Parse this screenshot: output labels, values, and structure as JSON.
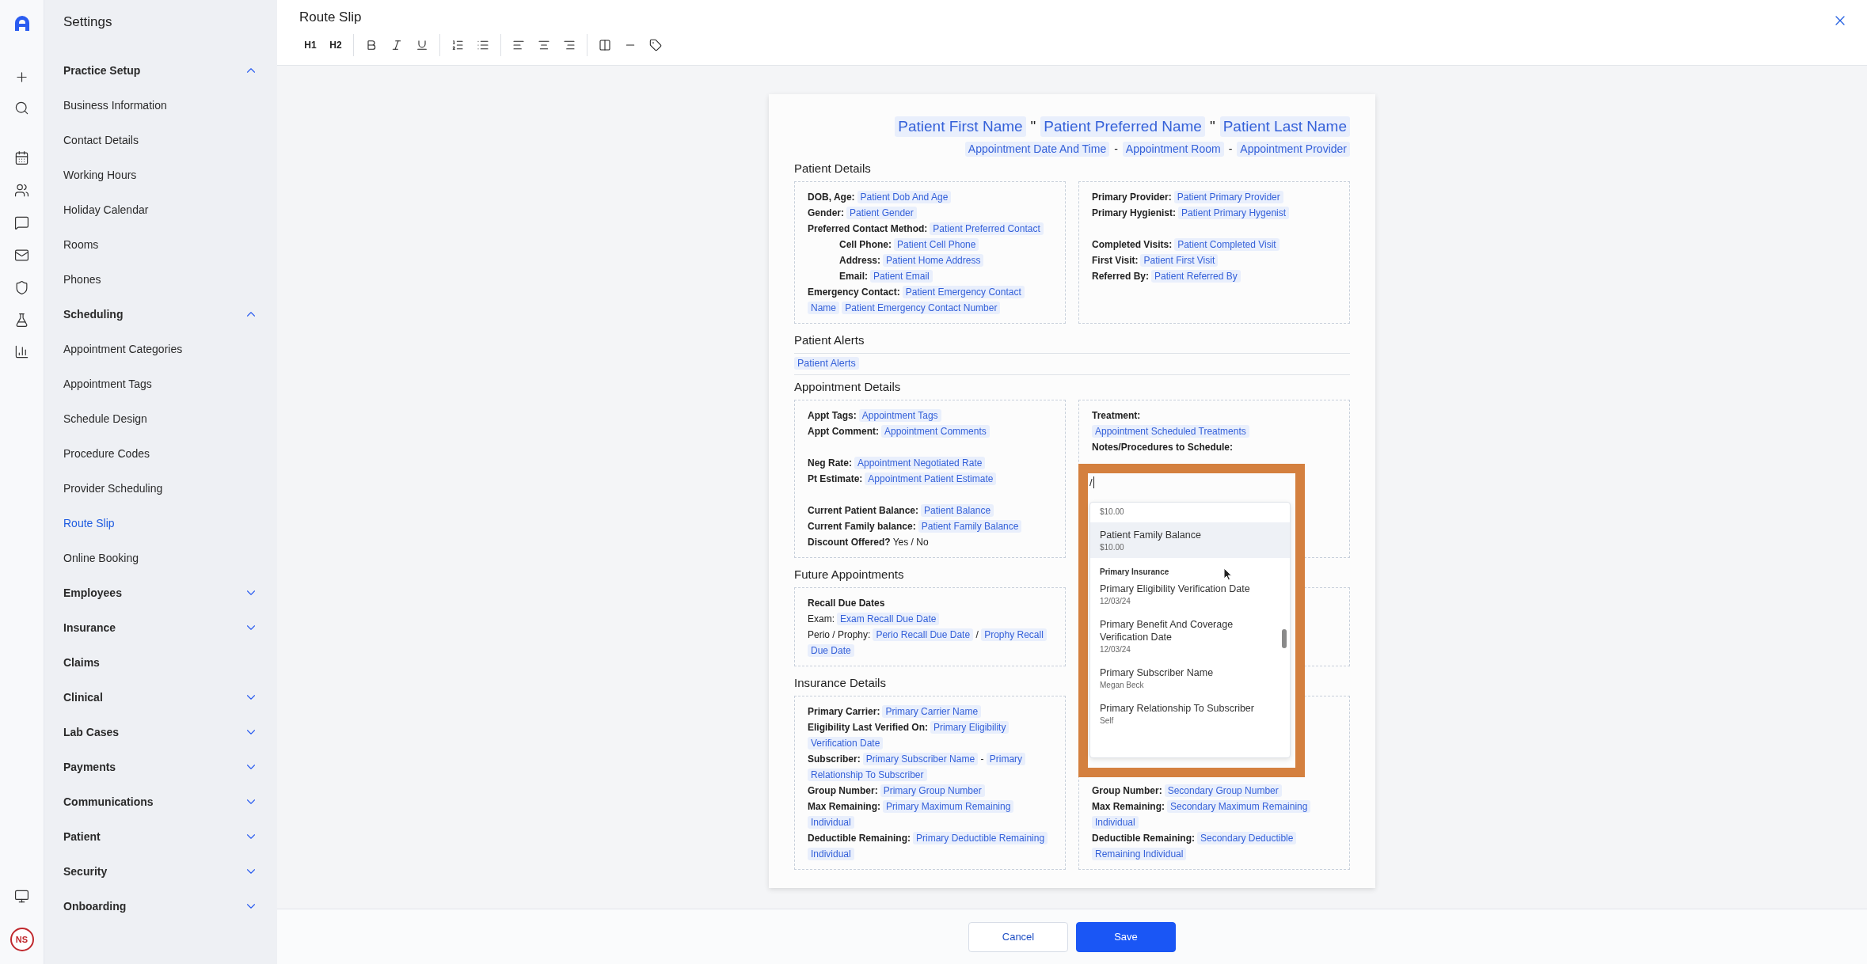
{
  "sidebar": {
    "title": "Settings",
    "sections": [
      {
        "label": "Practice Setup",
        "kind": "group",
        "expanded": true,
        "items": [
          {
            "label": "Business Information",
            "selected": false
          },
          {
            "label": "Contact Details",
            "selected": false
          },
          {
            "label": "Working Hours",
            "selected": false
          },
          {
            "label": "Holiday Calendar",
            "selected": false
          },
          {
            "label": "Rooms",
            "selected": false
          },
          {
            "label": "Phones",
            "selected": false
          }
        ]
      },
      {
        "label": "Scheduling",
        "kind": "group",
        "expanded": true,
        "items": [
          {
            "label": "Appointment Categories",
            "selected": false
          },
          {
            "label": "Appointment Tags",
            "selected": false
          },
          {
            "label": "Schedule Design",
            "selected": false
          },
          {
            "label": "Procedure Codes",
            "selected": false
          },
          {
            "label": "Provider Scheduling",
            "selected": false
          },
          {
            "label": "Route Slip",
            "selected": true
          },
          {
            "label": "Online Booking",
            "selected": false
          }
        ]
      },
      {
        "label": "Employees",
        "kind": "group",
        "expanded": false
      },
      {
        "label": "Insurance",
        "kind": "group",
        "expanded": false
      },
      {
        "label": "Claims",
        "kind": "link"
      },
      {
        "label": "Clinical",
        "kind": "group",
        "expanded": false
      },
      {
        "label": "Lab Cases",
        "kind": "group",
        "expanded": false
      },
      {
        "label": "Payments",
        "kind": "group",
        "expanded": false
      },
      {
        "label": "Communications",
        "kind": "group",
        "expanded": false
      },
      {
        "label": "Patient",
        "kind": "group",
        "expanded": false
      },
      {
        "label": "Security",
        "kind": "group",
        "expanded": false
      },
      {
        "label": "Onboarding",
        "kind": "group",
        "expanded": false
      }
    ]
  },
  "avatar": {
    "initials": "NS"
  },
  "editor": {
    "title": "Route Slip",
    "toolbar": [
      [
        {
          "kind": "text",
          "label": "H1"
        },
        {
          "kind": "text",
          "label": "H2"
        }
      ],
      [
        {
          "kind": "bold"
        },
        {
          "kind": "italic"
        },
        {
          "kind": "underline"
        }
      ],
      [
        {
          "kind": "numbered-list"
        },
        {
          "kind": "bullet-list"
        }
      ],
      [
        {
          "kind": "align-left"
        },
        {
          "kind": "align-center"
        },
        {
          "kind": "align-right"
        }
      ],
      [
        {
          "kind": "columns"
        },
        {
          "kind": "rule"
        },
        {
          "kind": "tag"
        }
      ]
    ]
  },
  "document": {
    "title_line": [
      {
        "kind": "chip",
        "text": "Patient First Name"
      },
      {
        "kind": "text",
        "text": "\""
      },
      {
        "kind": "chip",
        "text": "Patient Preferred Name"
      },
      {
        "kind": "text",
        "text": "\""
      },
      {
        "kind": "chip",
        "text": "Patient Last Name"
      }
    ],
    "subtitle_line": [
      {
        "kind": "chip",
        "text": "Appointment Date And Time"
      },
      {
        "kind": "text",
        "text": "-"
      },
      {
        "kind": "chip",
        "text": "Appointment Room"
      },
      {
        "kind": "text",
        "text": "-"
      },
      {
        "kind": "chip",
        "text": "Appointment Provider"
      }
    ],
    "sections": [
      {
        "heading": "Patient Details",
        "boxes": [
          {
            "lines": [
              {
                "kind": "field",
                "label": "DOB, Age:",
                "parts": [
                  {
                    "kind": "chip",
                    "text": "Patient Dob And Age"
                  }
                ]
              },
              {
                "kind": "field",
                "label": "Gender:",
                "parts": [
                  {
                    "kind": "chip",
                    "text": "Patient Gender"
                  }
                ]
              },
              {
                "kind": "field",
                "label": "Preferred Contact Method:",
                "parts": [
                  {
                    "kind": "chip",
                    "text": "Patient Preferred Contact"
                  }
                ],
                "children": [
                  {
                    "kind": "field",
                    "label": "Cell Phone:",
                    "parts": [
                      {
                        "kind": "chip",
                        "text": "Patient Cell Phone"
                      }
                    ]
                  },
                  {
                    "kind": "field",
                    "label": "Address:",
                    "parts": [
                      {
                        "kind": "chip",
                        "text": "Patient Home Address"
                      }
                    ]
                  },
                  {
                    "kind": "field",
                    "label": "Email:",
                    "parts": [
                      {
                        "kind": "chip",
                        "text": "Patient Email"
                      }
                    ]
                  }
                ]
              },
              {
                "kind": "field",
                "label": "Emergency Contact:",
                "parts": [
                  {
                    "kind": "chip",
                    "text": "Patient Emergency Contact"
                  },
                  {
                    "kind": "chip",
                    "text": "Name"
                  },
                  {
                    "kind": "chip",
                    "text": "Patient Emergency Contact Number"
                  }
                ]
              }
            ]
          },
          {
            "lines": [
              {
                "kind": "field",
                "label": "Primary Provider:",
                "parts": [
                  {
                    "kind": "chip",
                    "text": "Patient Primary Provider"
                  }
                ]
              },
              {
                "kind": "field",
                "label": "Primary Hygienist:",
                "parts": [
                  {
                    "kind": "chip",
                    "text": "Patient Primary Hygenist"
                  }
                ]
              },
              {
                "kind": "gap"
              },
              {
                "kind": "field",
                "label": "Completed Visits:",
                "parts": [
                  {
                    "kind": "chip",
                    "text": "Patient Completed Visit"
                  }
                ]
              },
              {
                "kind": "field",
                "label": "First Visit:",
                "parts": [
                  {
                    "kind": "chip",
                    "text": "Patient First Visit"
                  }
                ]
              },
              {
                "kind": "field",
                "label": "Referred By:",
                "parts": [
                  {
                    "kind": "chip",
                    "text": "Patient Referred By"
                  }
                ]
              }
            ]
          }
        ]
      },
      {
        "heading": "Patient Alerts",
        "parts": [
          {
            "kind": "chip",
            "text": "Patient Alerts"
          }
        ]
      },
      {
        "heading": "Appointment Details",
        "boxes": [
          {
            "lines": [
              {
                "kind": "field",
                "label": "Appt Tags:",
                "parts": [
                  {
                    "kind": "chip",
                    "text": "Appointment Tags"
                  }
                ]
              },
              {
                "kind": "field",
                "label": "Appt Comment:",
                "parts": [
                  {
                    "kind": "chip",
                    "text": "Appointment Comments"
                  }
                ]
              },
              {
                "kind": "gap"
              },
              {
                "kind": "field",
                "label": "Neg Rate:",
                "parts": [
                  {
                    "kind": "chip",
                    "text": "Appointment Negotiated Rate"
                  }
                ]
              },
              {
                "kind": "field",
                "label": "Pt Estimate:",
                "parts": [
                  {
                    "kind": "chip",
                    "text": "Appointment Patient Estimate"
                  }
                ]
              },
              {
                "kind": "gap"
              },
              {
                "kind": "field",
                "label": "Current Patient Balance:",
                "parts": [
                  {
                    "kind": "chip",
                    "text": "Patient Balance"
                  }
                ]
              },
              {
                "kind": "field",
                "label": "Current Family balance:",
                "parts": [
                  {
                    "kind": "chip",
                    "text": "Patient Family Balance"
                  }
                ]
              },
              {
                "kind": "field",
                "label": "Discount Offered?",
                "parts": [
                  {
                    "kind": "text",
                    "text": "Yes / No"
                  }
                ]
              }
            ]
          },
          {
            "lines": [
              {
                "kind": "field",
                "label": "Treatment:"
              },
              {
                "kind": "field",
                "parts": [
                  {
                    "kind": "chip",
                    "text": "Appointment Scheduled Treatments"
                  }
                ]
              },
              {
                "kind": "field",
                "label": "Notes/Procedures to Schedule:"
              }
            ],
            "menu": {
              "query": "/",
              "items": [
                {
                  "kind": "option",
                  "detail": "$10.00",
                  "selected": false
                },
                {
                  "kind": "option",
                  "title": "Patient Family Balance",
                  "detail": "$10.00",
                  "selected": true
                },
                {
                  "kind": "group",
                  "label": "Primary Insurance"
                },
                {
                  "kind": "option",
                  "title": "Primary Eligibility Verification Date",
                  "detail": "12/03/24",
                  "selected": false
                },
                {
                  "kind": "option",
                  "title": "Primary Benefit And Coverage Verification Date",
                  "detail": "12/03/24",
                  "selected": false
                },
                {
                  "kind": "option",
                  "title": "Primary Subscriber Name",
                  "detail": "Megan Beck",
                  "selected": false
                },
                {
                  "kind": "option",
                  "title": "Primary Relationship To Subscriber",
                  "detail": "Self",
                  "selected": false
                }
              ]
            }
          }
        ]
      },
      {
        "heading": "Future Appointments",
        "boxes": [
          {
            "lines": [
              {
                "kind": "field",
                "label": "Recall Due Dates"
              },
              {
                "kind": "plain",
                "label": "Exam:",
                "parts": [
                  {
                    "kind": "chip",
                    "text": "Exam Recall Due Date"
                  }
                ]
              },
              {
                "kind": "plain",
                "label": "Perio / Prophy:",
                "parts": [
                  {
                    "kind": "chip",
                    "text": "Perio Recall Due Date"
                  },
                  {
                    "kind": "text",
                    "text": "/"
                  },
                  {
                    "kind": "chip",
                    "text": "Prophy Recall"
                  },
                  {
                    "kind": "chip",
                    "text": "Due Date"
                  }
                ]
              }
            ]
          },
          {
            "lines": [
              {
                "kind": "gap"
              },
              {
                "kind": "gap"
              },
              {
                "kind": "gap"
              }
            ]
          }
        ]
      },
      {
        "heading": "Insurance Details",
        "boxes": [
          {
            "lines": [
              {
                "kind": "field",
                "label": "Primary Carrier:",
                "parts": [
                  {
                    "kind": "chip",
                    "text": "Primary Carrier Name"
                  }
                ]
              },
              {
                "kind": "field",
                "label": "Eligibility Last Verified On:",
                "parts": [
                  {
                    "kind": "chip",
                    "text": "Primary Eligibility"
                  },
                  {
                    "kind": "chip",
                    "text": "Verification Date"
                  }
                ]
              },
              {
                "kind": "field",
                "label": "Subscriber:",
                "parts": [
                  {
                    "kind": "chip",
                    "text": "Primary Subscriber Name"
                  },
                  {
                    "kind": "text",
                    "text": "-"
                  },
                  {
                    "kind": "chip",
                    "text": "Primary"
                  },
                  {
                    "kind": "chip",
                    "text": "Relationship To Subscriber"
                  }
                ]
              },
              {
                "kind": "field",
                "label": "Group Number:",
                "parts": [
                  {
                    "kind": "chip",
                    "text": "Primary Group Number"
                  }
                ]
              },
              {
                "kind": "field",
                "label": "Max Remaining:",
                "parts": [
                  {
                    "kind": "chip",
                    "text": "Primary Maximum Remaining"
                  },
                  {
                    "kind": "chip",
                    "text": "Individual"
                  }
                ]
              },
              {
                "kind": "field",
                "label": "Deductible Remaining:",
                "parts": [
                  {
                    "kind": "chip",
                    "text": "Primary Deductible Remaining"
                  },
                  {
                    "kind": "chip",
                    "text": "Individual"
                  }
                ]
              }
            ]
          },
          {
            "lines": [
              {
                "kind": "gap"
              },
              {
                "kind": "gap"
              },
              {
                "kind": "gap"
              },
              {
                "kind": "gap"
              },
              {
                "kind": "gap"
              },
              {
                "kind": "field",
                "label": "Group Number:",
                "parts": [
                  {
                    "kind": "chip",
                    "text": "Secondary Group Number"
                  }
                ]
              },
              {
                "kind": "field",
                "label": "Max Remaining:",
                "parts": [
                  {
                    "kind": "chip",
                    "text": "Secondary Maximum Remaining"
                  },
                  {
                    "kind": "chip",
                    "text": "Individual"
                  }
                ]
              },
              {
                "kind": "field",
                "label": "Deductible Remaining:",
                "parts": [
                  {
                    "kind": "chip",
                    "text": "Secondary Deductible"
                  },
                  {
                    "kind": "chip",
                    "text": "Remaining Individual"
                  }
                ]
              }
            ]
          }
        ]
      }
    ]
  },
  "footer": {
    "buttons": [
      {
        "label": "Cancel",
        "kind": "secondary"
      },
      {
        "label": "Save",
        "kind": "primary"
      }
    ]
  }
}
